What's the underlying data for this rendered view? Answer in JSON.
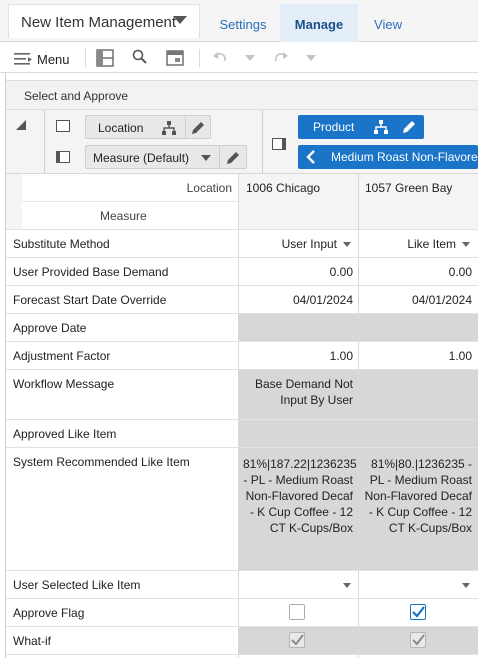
{
  "app": {
    "title": "New Item Management"
  },
  "tabs": [
    {
      "label": "Settings"
    },
    {
      "label": "Manage"
    },
    {
      "label": "View"
    }
  ],
  "toolbar": {
    "menu_label": "Menu"
  },
  "section": {
    "title": "Select and Approve"
  },
  "layout": {
    "location_label": "Location",
    "measure_label": "Measure (Default)",
    "product_label": "Product",
    "product_value": "Medium Roast Non-Flavore"
  },
  "grid": {
    "location_header": "Location",
    "measure_header": "Measure",
    "columns": [
      {
        "label": "1006 Chicago"
      },
      {
        "label": "1057 Green Bay"
      }
    ],
    "rows": [
      {
        "label": "Substitute Method",
        "values": [
          "User Input",
          "Like Item"
        ]
      },
      {
        "label": "User Provided Base Demand",
        "values": [
          "0.00",
          "0.00"
        ]
      },
      {
        "label": "Forecast Start Date Override",
        "values": [
          "04/01/2024",
          "04/01/2024"
        ]
      },
      {
        "label": "Approve Date",
        "values": [
          "",
          ""
        ]
      },
      {
        "label": "Adjustment Factor",
        "values": [
          "1.00",
          "1.00"
        ]
      },
      {
        "label": "Workflow Message",
        "values": [
          "Base Demand Not Input By User",
          ""
        ]
      },
      {
        "label": "Approved Like Item",
        "values": [
          "",
          ""
        ]
      },
      {
        "label": "System Recommended Like Item",
        "values": [
          "81%|187.22|1236235 - PL - Medium Roast Non-Flavored Decaf - K Cup Coffee - 12 CT K-Cups/Box",
          "81%|80.|1236235 - PL - Medium Roast Non-Flavored Decaf - K Cup Coffee - 12 CT K-Cups/Box"
        ]
      },
      {
        "label": "User Selected Like Item",
        "values": [
          "",
          ""
        ]
      },
      {
        "label": "Approve Flag",
        "checked": [
          false,
          true
        ]
      },
      {
        "label": "What-if",
        "checked": [
          true,
          true
        ]
      }
    ]
  },
  "colors": {
    "accent": "#1a74c8",
    "tab_active_bg": "#e3eef9",
    "readonly_cell": "#d7d7d7"
  }
}
